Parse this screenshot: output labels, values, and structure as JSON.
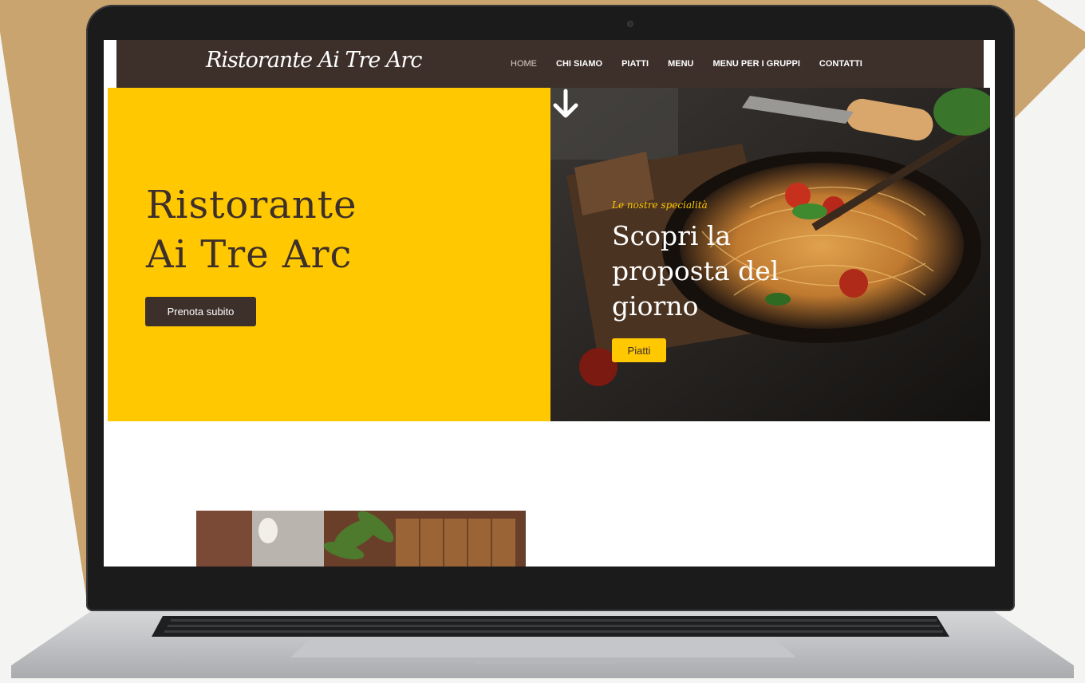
{
  "site": {
    "brand": "Ristorante Ai Tre Arc",
    "nav": [
      {
        "label": "HOME",
        "active": true
      },
      {
        "label": "CHI SIAMO",
        "active": false
      },
      {
        "label": "PIATTI",
        "active": false
      },
      {
        "label": "MENU",
        "active": false
      },
      {
        "label": "MENU PER I GRUPPI",
        "active": false
      },
      {
        "label": "CONTATTI",
        "active": false
      }
    ]
  },
  "hero": {
    "title_line1": "Ristorante",
    "title_line2": "Ai Tre Arc",
    "cta_label": "Prenota subito"
  },
  "feature": {
    "kicker": "Le nostre specialità",
    "sub_line1": "Scopri la",
    "sub_line2": "proposta del",
    "sub_line3": "giorno",
    "cta_label": "Piatti"
  },
  "colors": {
    "accent": "#ffc800",
    "brand_dark": "#3d2f2a",
    "backdrop_tan": "#c9a46e"
  },
  "icons": {
    "scroll": "arrow-down-icon"
  }
}
